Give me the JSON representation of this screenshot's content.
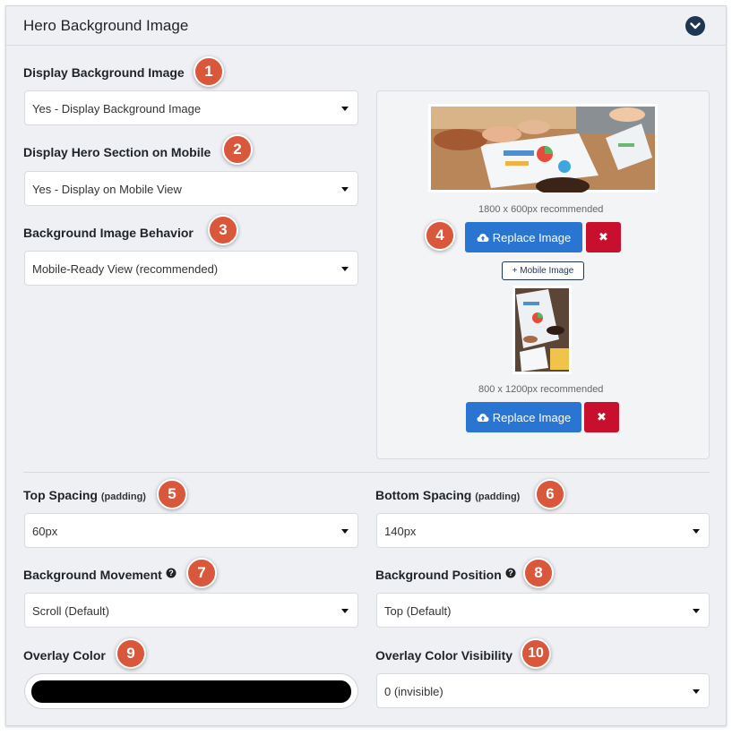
{
  "panel": {
    "title": "Hero Background Image"
  },
  "fields": {
    "display_bg": {
      "label": "Display Background Image",
      "value": "Yes - Display Background Image",
      "badge": "1"
    },
    "display_mobile": {
      "label": "Display Hero Section on Mobile",
      "value": "Yes - Display on Mobile View",
      "badge": "2"
    },
    "behavior": {
      "label": "Background Image Behavior",
      "value": "Mobile-Ready View (recommended)",
      "badge": "3"
    },
    "top_spacing": {
      "label": "Top Spacing",
      "sub": "(padding)",
      "value": "60px",
      "badge": "5"
    },
    "bottom_spacing": {
      "label": "Bottom Spacing",
      "sub": "(padding)",
      "value": "140px",
      "badge": "6"
    },
    "movement": {
      "label": "Background Movement",
      "value": "Scroll (Default)",
      "badge": "7"
    },
    "position": {
      "label": "Background Position",
      "value": "Top (Default)",
      "badge": "8"
    },
    "overlay_color": {
      "label": "Overlay Color",
      "value": "#000000",
      "badge": "9"
    },
    "overlay_visibility": {
      "label": "Overlay Color Visibility",
      "value": "0 (invisible)",
      "badge": "10"
    }
  },
  "images": {
    "desktop_hint": "1800 x 600px recommended",
    "replace_label": "Replace Image",
    "badge": "4",
    "add_mobile_label": "+ Mobile Image",
    "mobile_hint": "800 x 1200px recommended",
    "mobile_replace_label": "Replace Image",
    "remove_symbol": "✖"
  },
  "colors": {
    "badge": "#d9573a",
    "primary_button": "#2a74d2",
    "danger_button": "#c8102e",
    "header_icon": "#1e3652",
    "overlay": "#000000"
  },
  "icons": {
    "collapse": "chevron-down-icon",
    "upload": "cloud-upload-icon",
    "remove": "close-icon",
    "help": "question-circle-icon"
  }
}
